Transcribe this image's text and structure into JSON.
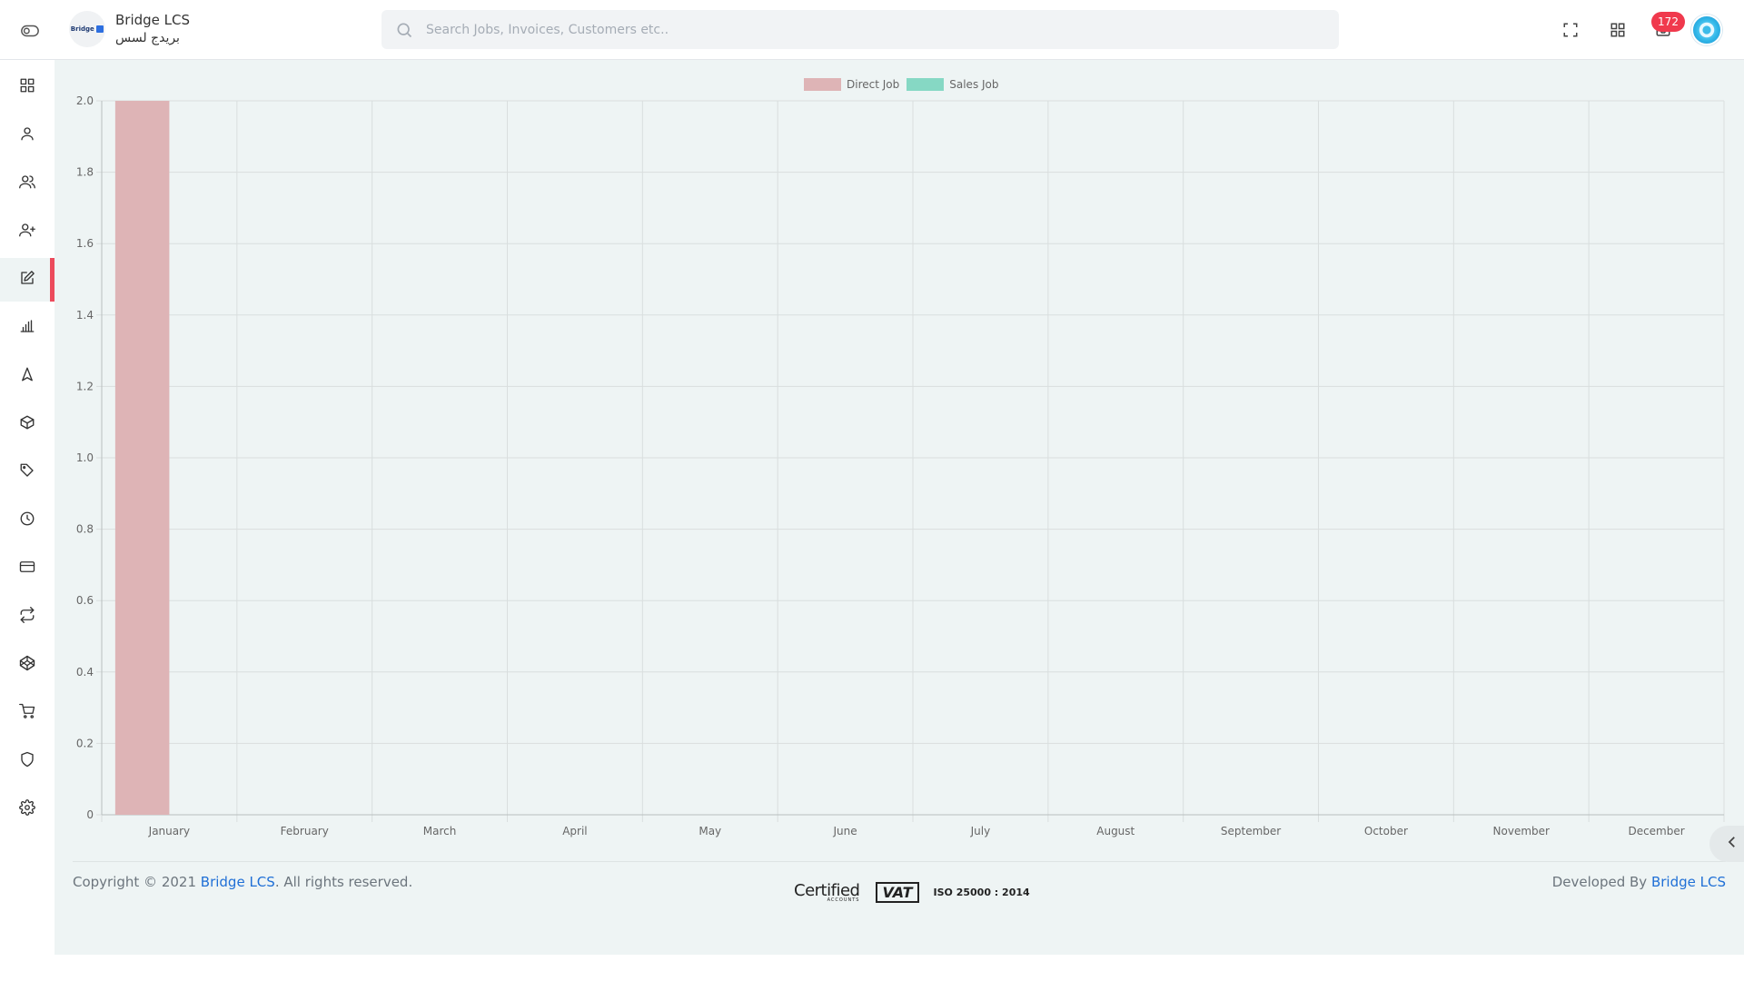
{
  "brand": {
    "name": "Bridge LCS",
    "name_arabic": "بريدج لسس",
    "logo_text": "Bridge"
  },
  "search": {
    "placeholder": "Search Jobs, Invoices, Customers etc.."
  },
  "header": {
    "notification_count": "172"
  },
  "sidebar": {
    "items": [
      {
        "icon": "dashboard-icon",
        "active": false
      },
      {
        "icon": "user-icon",
        "active": false
      },
      {
        "icon": "users-icon",
        "active": false
      },
      {
        "icon": "user-plus-icon",
        "active": false
      },
      {
        "icon": "edit-icon",
        "active": true
      },
      {
        "icon": "bar-chart-icon",
        "active": false
      },
      {
        "icon": "navigation-icon",
        "active": false
      },
      {
        "icon": "box-icon",
        "active": false
      },
      {
        "icon": "tag-icon",
        "active": false
      },
      {
        "icon": "clock-icon",
        "active": false
      },
      {
        "icon": "credit-card-icon",
        "active": false
      },
      {
        "icon": "repeat-icon",
        "active": false
      },
      {
        "icon": "codepen-icon",
        "active": false
      },
      {
        "icon": "cart-icon",
        "active": false
      },
      {
        "icon": "shield-icon",
        "active": false
      },
      {
        "icon": "settings-icon",
        "active": false
      }
    ]
  },
  "chart_data": {
    "type": "bar",
    "categories": [
      "January",
      "February",
      "March",
      "April",
      "May",
      "June",
      "July",
      "August",
      "September",
      "October",
      "November",
      "December"
    ],
    "series": [
      {
        "name": "Direct Job",
        "values": [
          2,
          0,
          0,
          0,
          0,
          0,
          0,
          0,
          0,
          0,
          0,
          0
        ],
        "color": "#deb4b6"
      },
      {
        "name": "Sales Job",
        "values": [
          0,
          0,
          0,
          0,
          0,
          0,
          0,
          0,
          0,
          0,
          0,
          0
        ],
        "color": "#86d8c4"
      }
    ],
    "ylim": [
      0,
      2
    ],
    "yticks": [
      "0",
      "0.2",
      "0.4",
      "0.6",
      "0.8",
      "1.0",
      "1.2",
      "1.4",
      "1.6",
      "1.8",
      "2.0"
    ],
    "grid": true,
    "legend": "top-center"
  },
  "footer": {
    "copyright_prefix": "Copyright © 2021 ",
    "copyright_link": "Bridge LCS",
    "copyright_suffix": ". All rights reserved.",
    "dev_prefix": "Developed By ",
    "dev_link": "Bridge LCS",
    "cert_certified": "Certified",
    "cert_certified_sub": "ACCOUNTS",
    "cert_vat": "VAT",
    "cert_iso": "ISO 25000 : 2014"
  },
  "colors": {
    "accent": "#ec4b5c",
    "link": "#1f6fd6",
    "badge": "#f0394d"
  }
}
